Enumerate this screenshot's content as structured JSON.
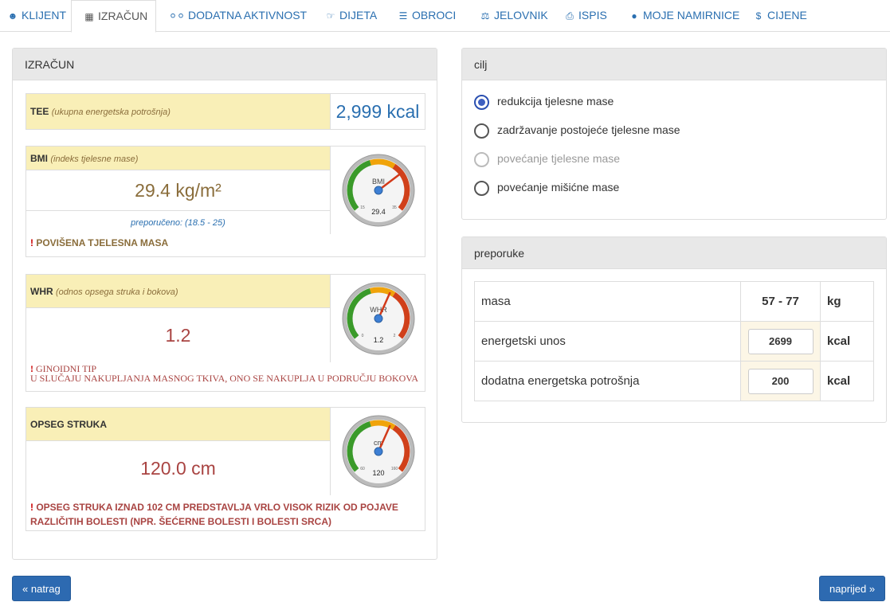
{
  "tabs": [
    {
      "label": "KLIJENT",
      "icon": "user-icon"
    },
    {
      "label": "IZRAČUN",
      "icon": "calculator-icon"
    },
    {
      "label": "DODATNA AKTIVNOST",
      "icon": "bicycle-icon"
    },
    {
      "label": "DIJETA",
      "icon": "thumbs-up-icon"
    },
    {
      "label": "OBROCI",
      "icon": "list-icon"
    },
    {
      "label": "JELOVNIK",
      "icon": "cutlery-icon"
    },
    {
      "label": "ISPIS",
      "icon": "print-icon"
    },
    {
      "label": "MOJE NAMIRNICE",
      "icon": "apple-icon"
    },
    {
      "label": "CIJENE",
      "icon": "dollar-icon"
    }
  ],
  "izracun": {
    "title": "IZRAČUN",
    "tee": {
      "label": "TEE",
      "desc": "(ukupna energetska potrošnja)",
      "value": "2,999 kcal"
    },
    "bmi": {
      "label": "BMI",
      "desc": "(indeks tjelesne mase)",
      "value": "29.4 kg/m²",
      "recommended": "preporučeno: (18.5 - 25)",
      "warning": "POVIŠENA TJELESNA MASA",
      "gauge": {
        "unit": "BMI",
        "reading": "29.4",
        "min_label": "15",
        "max_label": "35",
        "level": 0.72
      }
    },
    "whr": {
      "label": "WHR",
      "desc": "(odnos opsega struka i bokova)",
      "value": "1.2",
      "warning_title": "GINOIDNI TIP",
      "warning_text": "U SLUČAJU NAKUPLJANJA MASNOG TKIVA, ONO SE NAKUPLJA U PODRUČJU BOKOVA",
      "gauge": {
        "unit": "WHR",
        "reading": "1.2",
        "min_label": "0",
        "max_label": "2",
        "level": 0.6
      }
    },
    "struk": {
      "label": "OPSEG STRUKA",
      "value": "120.0 cm",
      "warning": "OPSEG STRUKA IZNAD 102 CM PREDSTAVLJA VRLO VISOK RIZIK OD POJAVE RAZLIČITIH BOLESTI (NPR. ŠEĆERNE BOLESTI I BOLESTI SRCA)",
      "gauge": {
        "unit": "cm",
        "reading": "120",
        "min_label": "60",
        "max_label": "160",
        "level": 0.6
      }
    }
  },
  "cilj": {
    "title": "cilj",
    "options": [
      {
        "label": "redukcija tjelesne mase",
        "checked": true,
        "disabled": false
      },
      {
        "label": "zadržavanje postojeće tjelesne mase",
        "checked": false,
        "disabled": false
      },
      {
        "label": "povećanje tjelesne mase",
        "checked": false,
        "disabled": true
      },
      {
        "label": "povećanje mišićne mase",
        "checked": false,
        "disabled": false
      }
    ]
  },
  "preporuke": {
    "title": "preporuke",
    "rows": [
      {
        "label": "masa",
        "value": "57 - 77",
        "unit": "kg"
      },
      {
        "label": "energetski unos",
        "value": "2699",
        "unit": "kcal"
      },
      {
        "label": "dodatna energetska potrošnja",
        "value": "200",
        "unit": "kcal"
      }
    ]
  },
  "nav": {
    "back": "natrag",
    "next": "naprijed"
  },
  "colors": {
    "link": "#2a6fb0",
    "label_bg": "#f9efb7",
    "bmi_value": "#8a6d3b",
    "alert_value": "#a94442",
    "button": "#2d6ab1"
  }
}
